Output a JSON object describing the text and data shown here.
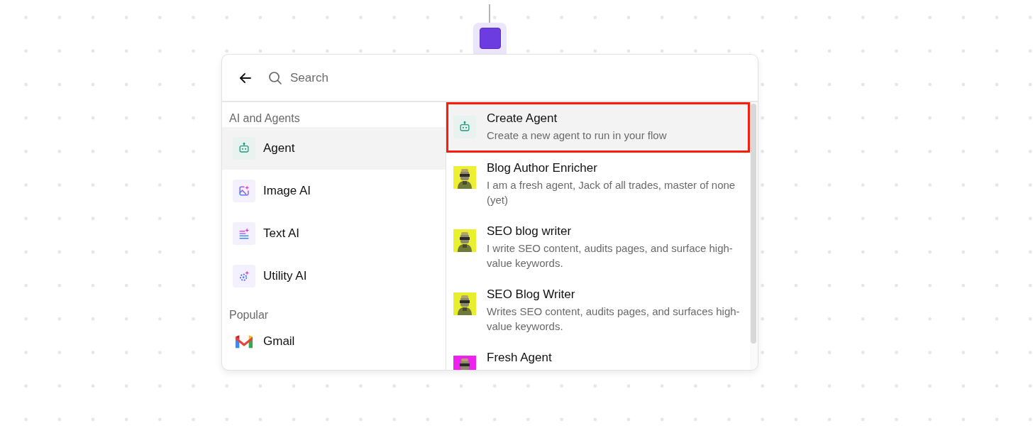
{
  "node": {
    "kind": "trigger"
  },
  "search": {
    "placeholder": "Search"
  },
  "categories": [
    {
      "kind": "section",
      "label": "AI and Agents"
    },
    {
      "kind": "item",
      "label": "Agent",
      "selected": true
    },
    {
      "kind": "item",
      "label": "Image AI",
      "selected": false
    },
    {
      "kind": "item",
      "label": "Text AI",
      "selected": false
    },
    {
      "kind": "item",
      "label": "Utility AI",
      "selected": false
    },
    {
      "kind": "section",
      "label": "Popular"
    },
    {
      "kind": "item",
      "label": "Gmail",
      "selected": false
    }
  ],
  "agents": [
    {
      "title": "Create Agent",
      "description": "Create a new agent to run in your flow",
      "kind": "create",
      "selected": true,
      "outlined": true
    },
    {
      "title": "Blog Author Enricher",
      "description": "I am a fresh agent, Jack of all trades, master of none (yet)",
      "kind": "agent",
      "selected": false,
      "outlined": false
    },
    {
      "title": "SEO blog writer",
      "description": "I write SEO content, audits pages, and surface high-value keywords.",
      "kind": "agent",
      "selected": false,
      "outlined": false
    },
    {
      "title": "SEO Blog Writer",
      "description": "Writes SEO content, audits pages, and surfaces high-value keywords.",
      "kind": "agent",
      "selected": false,
      "outlined": false
    },
    {
      "title": "Fresh Agent",
      "kind": "agent",
      "selected": false,
      "outlined": false
    }
  ]
}
